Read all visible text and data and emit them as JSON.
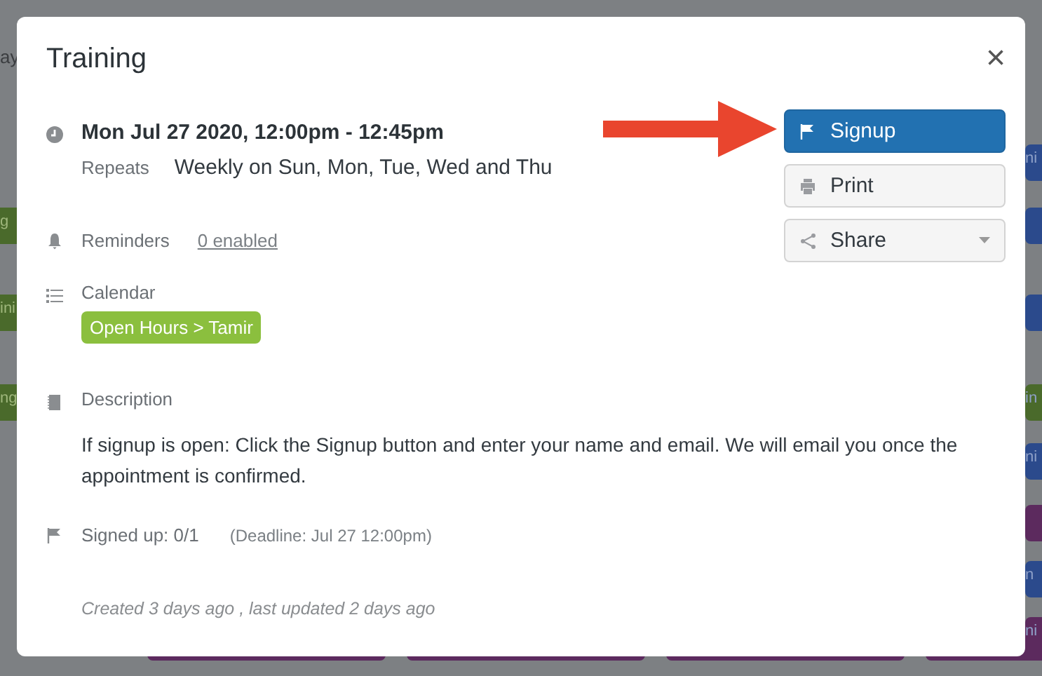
{
  "background": {
    "header_fragment": "ay",
    "left_events": [
      {
        "text": "g",
        "color": "#4a6a2b"
      },
      {
        "text": "ini",
        "color": "#4a6a2b"
      },
      {
        "text": "ng",
        "color": "#4a6a2b"
      }
    ],
    "right_events": [
      {
        "text": "ni",
        "color": "#2b4a8c"
      },
      {
        "color": "#2b4a8c"
      },
      {
        "color": "#2b4a8c"
      },
      {
        "text": "in",
        "color": "#4a6a2b"
      },
      {
        "text": "ni",
        "color": "#2b4a8c"
      },
      {
        "color": "#5c2a5e"
      },
      {
        "text": "n",
        "color": "#2b4a8c"
      },
      {
        "text": "ni",
        "color": "#5c2a5e"
      }
    ]
  },
  "modal": {
    "title": "Training",
    "close": "×",
    "when": "Mon Jul 27 2020, 12:00pm - 12:45pm",
    "repeats_label": "Repeats",
    "repeats": "Weekly on Sun, Mon, Tue, Wed and Thu",
    "reminders_label": "Reminders",
    "reminders_link": "0 enabled",
    "calendar_label": "Calendar",
    "calendar_tag": "Open Hours > Tamir",
    "description_label": "Description",
    "description": "If signup is open: Click the Signup button and enter your name and email. We will email you once the appointment is confirmed.",
    "signed_up": "Signed up: 0/1",
    "deadline": "(Deadline: Jul 27 12:00pm)",
    "footer": "Created 3 days ago , last updated 2 days ago",
    "buttons": [
      {
        "kind": "primary",
        "label": "Signup"
      },
      {
        "kind": "plain",
        "label": "Print"
      },
      {
        "kind": "dropdown",
        "label": "Share"
      }
    ]
  }
}
